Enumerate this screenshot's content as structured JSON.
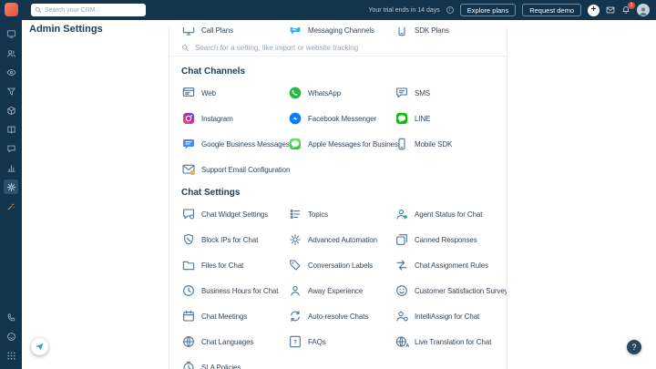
{
  "topbar": {
    "search_placeholder": "Search your CRM...",
    "trial_text": "Your trial ends in 14 days",
    "explore_plans_label": "Explore plans",
    "request_demo_label": "Request demo",
    "notification_count": "1"
  },
  "sidebar": {
    "top_icons": [
      {
        "name": "monitor"
      },
      {
        "name": "contacts"
      },
      {
        "name": "eye"
      },
      {
        "name": "funnel"
      },
      {
        "name": "cube"
      },
      {
        "name": "book"
      },
      {
        "name": "chat"
      },
      {
        "name": "chart"
      },
      {
        "name": "gear",
        "active": true
      },
      {
        "name": "wand"
      }
    ],
    "bottom_icons": [
      {
        "name": "phone"
      },
      {
        "name": "smiley"
      },
      {
        "name": "waffle"
      }
    ]
  },
  "page": {
    "title": "Admin Settings"
  },
  "panel": {
    "search_placeholder": "Search for a setting, like import or website tracking",
    "partial_items": [
      {
        "label": "Call Plans",
        "icon": "monitor"
      },
      {
        "label": "Messaging Channels",
        "icon": "bubble-color"
      },
      {
        "label": "SDK Plans",
        "icon": "mobile"
      }
    ],
    "sections": [
      {
        "title": "Chat Channels",
        "items": [
          {
            "label": "Web",
            "icon": "web"
          },
          {
            "label": "WhatsApp",
            "icon": "whatsapp"
          },
          {
            "label": "SMS",
            "icon": "sms"
          },
          {
            "label": "Instagram",
            "icon": "instagram"
          },
          {
            "label": "Facebook Messenger",
            "icon": "messenger"
          },
          {
            "label": "LINE",
            "icon": "line"
          },
          {
            "label": "Google Business Messages",
            "icon": "gbm"
          },
          {
            "label": "Apple Messages for Business",
            "icon": "apple-messages"
          },
          {
            "label": "Mobile SDK",
            "icon": "mobile"
          },
          {
            "label": "Support Email Configuration",
            "icon": "email-gear"
          }
        ]
      },
      {
        "title": "Chat Settings",
        "items": [
          {
            "label": "Chat Widget Settings",
            "icon": "widget"
          },
          {
            "label": "Topics",
            "icon": "topics"
          },
          {
            "label": "Agent Status for Chat",
            "icon": "agent-status"
          },
          {
            "label": "Block IPs for Chat",
            "icon": "shield"
          },
          {
            "label": "Advanced Automation",
            "icon": "gear"
          },
          {
            "label": "Canned Responses",
            "icon": "layers"
          },
          {
            "label": "Files for Chat",
            "icon": "folder"
          },
          {
            "label": "Conversation Labels",
            "icon": "tag"
          },
          {
            "label": "Chat Assignment Rules",
            "icon": "arrows"
          },
          {
            "label": "Business Hours for Chat",
            "icon": "clock"
          },
          {
            "label": "Away Experience",
            "icon": "person"
          },
          {
            "label": "Customer Satisfaction Survey",
            "icon": "smiley"
          },
          {
            "label": "Chat Meetings",
            "icon": "calendar"
          },
          {
            "label": "Auto-resolve Chats",
            "icon": "refresh"
          },
          {
            "label": "IntelliAssign for Chat",
            "icon": "person-gear"
          },
          {
            "label": "Chat Languages",
            "icon": "globe"
          },
          {
            "label": "FAQs",
            "icon": "faq"
          },
          {
            "label": "Live Translation for Chat",
            "icon": "translate"
          },
          {
            "label": "SLA Policies",
            "icon": "timer"
          }
        ]
      }
    ]
  },
  "floating": {
    "help_label": "?"
  }
}
